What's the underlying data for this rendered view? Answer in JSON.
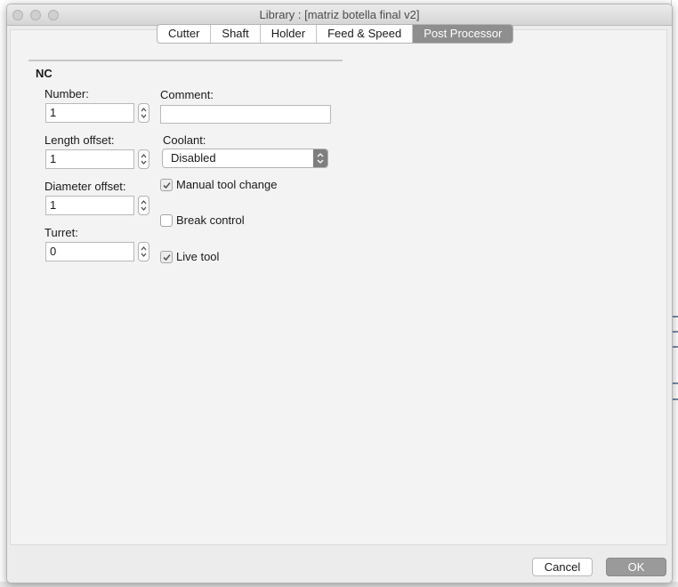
{
  "window": {
    "title": "Library :  [matriz botella final v2]"
  },
  "tabs": [
    {
      "label": "Cutter"
    },
    {
      "label": "Shaft"
    },
    {
      "label": "Holder"
    },
    {
      "label": "Feed & Speed"
    },
    {
      "label": "Post Processor",
      "active": true
    }
  ],
  "nc": {
    "title": "NC",
    "number": {
      "label": "Number:",
      "value": "1"
    },
    "length_offset": {
      "label": "Length offset:",
      "value": "1"
    },
    "diameter_offset": {
      "label": "Diameter offset:",
      "value": "1"
    },
    "turret": {
      "label": "Turret:",
      "value": "0"
    },
    "comment": {
      "label": "Comment:",
      "value": ""
    },
    "coolant": {
      "label": "Coolant:",
      "value": "Disabled"
    },
    "manual_tool_change": {
      "label": "Manual tool change",
      "checked": true
    },
    "break_control": {
      "label": "Break control",
      "checked": false
    },
    "live_tool": {
      "label": "Live tool",
      "checked": true
    }
  },
  "buttons": {
    "cancel": "Cancel",
    "ok": "OK"
  },
  "colors": {
    "active_tab": "#8e8e8e",
    "ok_button": "#9a9a9a",
    "panel_bg": "#f3f3f3"
  },
  "icons": {
    "window_controls": [
      "close-icon",
      "minimize-icon",
      "zoom-icon"
    ],
    "stepper": [
      "chevron-up-icon",
      "chevron-down-icon"
    ],
    "checkbox": "checkmark-icon",
    "select": "updown-arrows-icon"
  }
}
